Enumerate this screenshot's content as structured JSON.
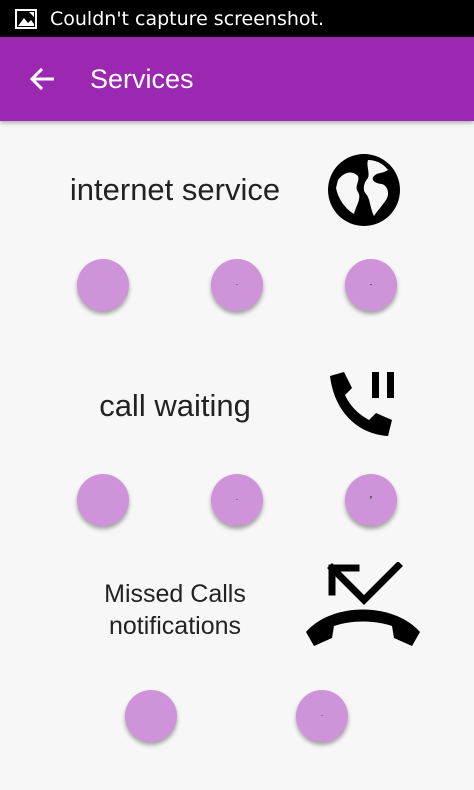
{
  "status_bar": {
    "text": "Couldn't capture screenshot.",
    "icon": "image-error-icon"
  },
  "app_bar": {
    "title": "Services",
    "back_icon": "arrow-back-icon",
    "color": "#9c27b0"
  },
  "sections": [
    {
      "title": "internet service",
      "icon": "globe-icon",
      "buttons": [
        {
          "icon": "circle-button"
        },
        {
          "icon": "circle-button",
          "mark": "·"
        },
        {
          "icon": "circle-button",
          "mark": "-"
        }
      ]
    },
    {
      "title": "call waiting",
      "icon": "phone-paused-icon",
      "buttons": [
        {
          "icon": "circle-button"
        },
        {
          "icon": "circle-button",
          "mark": "·"
        },
        {
          "icon": "circle-button",
          "mark": "°"
        }
      ]
    },
    {
      "title_lines": [
        "Missed Calls",
        "notifications"
      ],
      "icon": "phone-missed-icon",
      "buttons": [
        {
          "icon": "circle-button"
        },
        {
          "icon": "circle-button",
          "mark": "·"
        }
      ]
    }
  ],
  "colors": {
    "accent": "#9c27b0",
    "dot": "#ce93d8",
    "background": "#f7f7f7"
  }
}
